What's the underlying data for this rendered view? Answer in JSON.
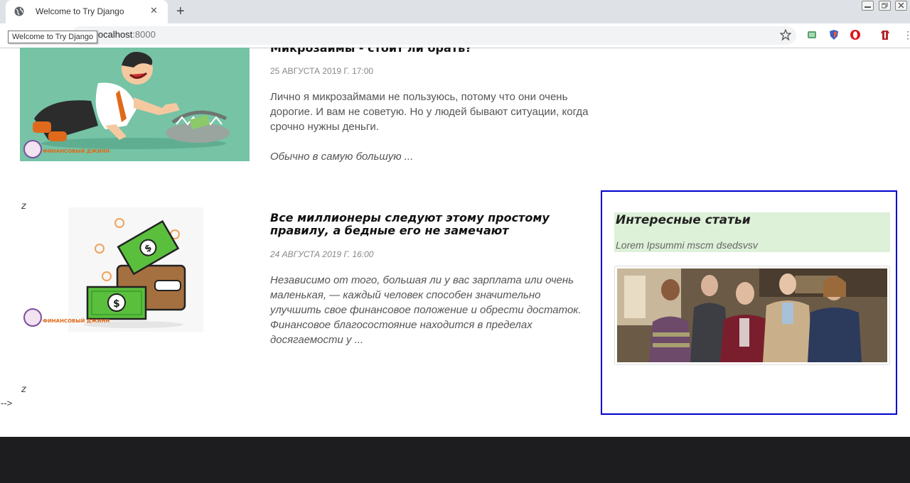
{
  "browser": {
    "tab_title": "Welcome to Try Django",
    "tooltip": "Welcome to Try Django",
    "url_host": "localhost",
    "url_port": ":8000",
    "new_tab": "+",
    "close": "✕",
    "menu": "⋮"
  },
  "posts": [
    {
      "title": "Микрозаймы - стоит ли брать?",
      "date": "25 АВГУСТА 2019 Г. 17:00",
      "excerpt": "Лично я микрозаймами не пользуюсь, потому что они очень дорогие. И вам не советую. Но у людей бывают ситуации, когда срочно нужны деньги.",
      "more": "Обычно в самую большую ...",
      "image_icon": "businessman-trap-illustration",
      "logo_text": "ФИНАНСОВЫЙ ДЖИНН"
    },
    {
      "title": "Все миллионеры следуют этому простому правилу, а бедные его не замечают",
      "date": "24 АВГУСТА 2019 Г. 16:00",
      "excerpt": "Независимо от того, большая ли у вас зарплата или очень маленькая, — каждый человек способен значительно улучшить свое финансовое положение и обрести достаток. Финансовое благосостояние находится в пределах досягаемости у ...",
      "image_icon": "wallet-money-illustration",
      "logo_text": "ФИНАНСОВЫЙ ДЖИНН"
    }
  ],
  "stray": {
    "z1": "z",
    "z2": "z",
    "arrow": "-->"
  },
  "sidebar": {
    "title": "Интересные статьи",
    "subtitle": "Lorem Ipsummi mscm dsedsvsv",
    "image_icon": "group-photo"
  },
  "colors": {
    "sidebar_border": "#0000cc",
    "sidebar_head_bg": "#ddf0d8",
    "footer_bg": "#1d1d1f",
    "post1_bg": "#76c3a6"
  }
}
